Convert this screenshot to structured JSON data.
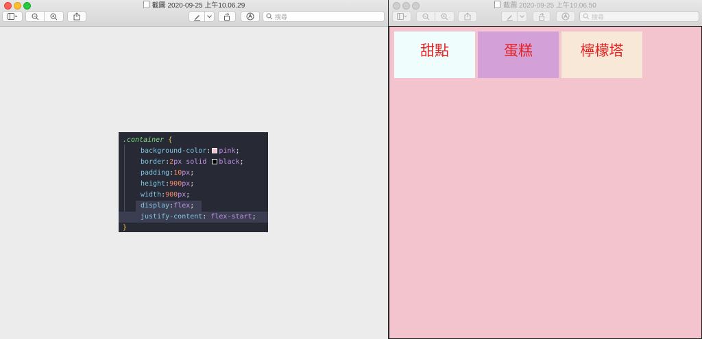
{
  "left_window": {
    "title": "截圖 2020-09-25 上午10.06.29",
    "search_placeholder": "搜尋"
  },
  "right_window": {
    "title": "截圖 2020-09-25 上午10.06.50",
    "search_placeholder": "搜尋",
    "items": [
      {
        "label": "甜點",
        "bg": "#f0fdfd"
      },
      {
        "label": "蛋糕",
        "bg": "#d4a0d8"
      },
      {
        "label": "檸檬塔",
        "bg": "#f8e8d8"
      }
    ]
  },
  "code": {
    "selector": ".container",
    "open_brace": "{",
    "close_brace": "}",
    "lines": [
      {
        "prop": "background-color",
        "value": "pink"
      },
      {
        "prop": "border",
        "num1": "2",
        "unit1": "px",
        "kw": "solid",
        "value": "black"
      },
      {
        "prop": "padding",
        "num": "10",
        "unit": "px"
      },
      {
        "prop": "height",
        "num": "900",
        "unit": "px"
      },
      {
        "prop": "width",
        "num": "900",
        "unit": "px"
      },
      {
        "prop": "display",
        "value": "flex"
      },
      {
        "prop": "justify-content",
        "value": "flex-start"
      }
    ]
  },
  "colors": {
    "pink_swatch": "#f7bfcc",
    "black_swatch": "#000000",
    "container_bg": "#f3c3ce",
    "item_text": "#e42020"
  }
}
